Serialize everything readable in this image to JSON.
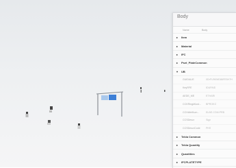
{
  "panel": {
    "title": "Body",
    "name_row": {
      "key": "Name",
      "value": "Body"
    },
    "sections_top": [
      {
        "label": "Item",
        "expanded": false
      },
      {
        "label": "Material",
        "expanded": false
      },
      {
        "label": "IFC",
        "expanded": false
      },
      {
        "label": "Pset_PlateCommon",
        "expanded": false
      }
    ],
    "ub_section": {
      "label": "UB",
      "expanded": true,
      "props": [
        {
          "key": "GUIDALIE",
          "value": "0DrFU9KWD86FE5H7H"
        },
        {
          "key": "KeyRFE",
          "value": "IDUPAID"
        },
        {
          "key": "AEDE_ME",
          "value": "ETHARI"
        },
        {
          "key": "CCKRingkKust...",
          "value": "BPROKO"
        },
        {
          "key": "CCHAfeiKum...",
          "value": "ELBE.COM.PRB"
        },
        {
          "key": "CCSDescr",
          "value": "Sign"
        },
        {
          "key": "CCSDescrCode",
          "value": "PHS"
        }
      ]
    },
    "sections_bottom": [
      {
        "label": "Tekla Common",
        "expanded": false
      },
      {
        "label": "Tekla Quantity",
        "expanded": false
      },
      {
        "label": "Quantities",
        "expanded": false
      },
      {
        "label": "IFCPLATETYPE",
        "expanded": false
      }
    ]
  },
  "viewport": {
    "sign_color": "#4a90d9"
  }
}
